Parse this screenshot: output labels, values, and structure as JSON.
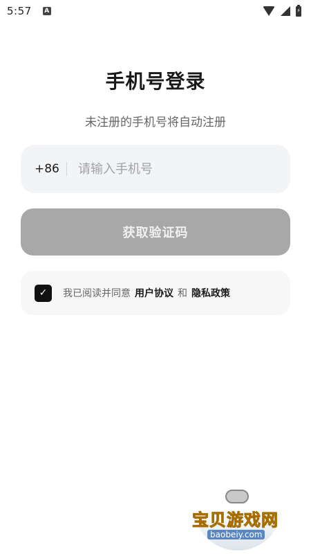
{
  "status_bar": {
    "time": "5:57",
    "notification_icon": "a-icon",
    "icons": [
      "wifi-icon",
      "signal-icon",
      "battery-charging-icon"
    ]
  },
  "login": {
    "title": "手机号登录",
    "subtitle": "未注册的手机号将自动注册",
    "country_code": "+86",
    "phone_placeholder": "请输入手机号",
    "phone_value": "",
    "submit_label": "获取验证码",
    "agreement": {
      "checked": true,
      "prefix": "我已阅读并同意",
      "user_agreement": "用户协议",
      "conjunction": "和",
      "privacy_policy": "隐私政策"
    }
  },
  "watermark": {
    "name": "宝贝游戏网",
    "url": "baobeiy.com"
  },
  "colors": {
    "button_disabled": "#a8a8a8",
    "input_bg": "#f3f4f6",
    "checkbox": "#111111"
  }
}
